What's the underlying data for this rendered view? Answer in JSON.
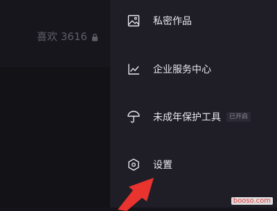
{
  "left": {
    "likes_label": "喜欢 3616"
  },
  "menu": [
    {
      "label": "私密作品",
      "icon": "private-works-icon"
    },
    {
      "label": "企业服务中心",
      "icon": "chart-icon"
    },
    {
      "label": "未成年保护工具",
      "icon": "umbrella-icon",
      "badge": "已开启"
    },
    {
      "label": "设置",
      "icon": "settings-icon"
    }
  ],
  "watermark": "booso.com",
  "colors": {
    "drawer_bg": "#1f1e27",
    "left_bg": "#131217",
    "arrow": "#e8332f",
    "text": "#e9e8ee"
  }
}
